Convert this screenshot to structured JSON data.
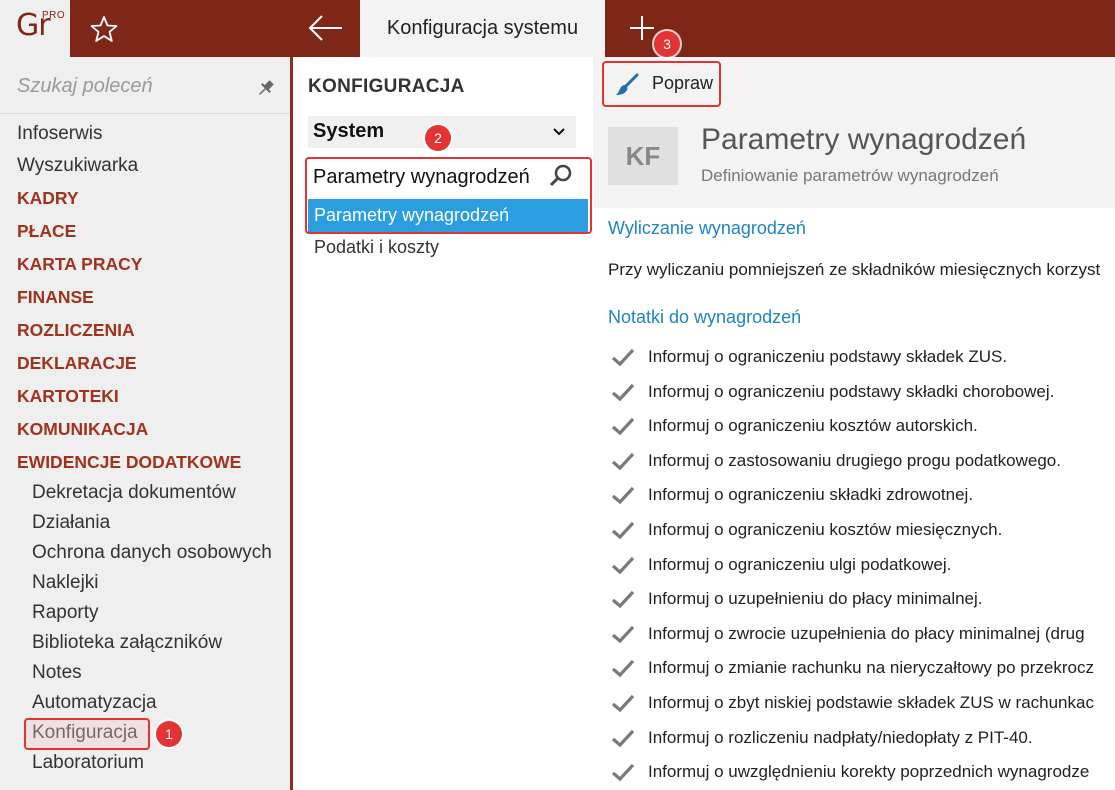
{
  "app": {
    "logo_text": "Gr",
    "logo_badge": "PRO",
    "active_tab": "Konfiguracja systemu"
  },
  "left": {
    "search_placeholder": "Szukaj poleceń",
    "items": [
      {
        "label": "Infoserwis",
        "kind": "item"
      },
      {
        "label": "Wyszukiwarka",
        "kind": "item"
      },
      {
        "label": "KADRY",
        "kind": "section"
      },
      {
        "label": "PŁACE",
        "kind": "section"
      },
      {
        "label": "KARTA PRACY",
        "kind": "section"
      },
      {
        "label": "FINANSE",
        "kind": "section"
      },
      {
        "label": "ROZLICZENIA",
        "kind": "section"
      },
      {
        "label": "DEKLARACJE",
        "kind": "section"
      },
      {
        "label": "KARTOTEKI",
        "kind": "section"
      },
      {
        "label": "KOMUNIKACJA",
        "kind": "section"
      },
      {
        "label": "EWIDENCJE DODATKOWE",
        "kind": "section"
      }
    ],
    "subitems": [
      "Dekretacja dokumentów",
      "Działania",
      "Ochrona danych osobowych",
      "Naklejki",
      "Raporty",
      "Biblioteka załączników",
      "Notes",
      "Automatyzacja",
      "Konfiguracja",
      "Laboratorium"
    ]
  },
  "middle": {
    "title": "KONFIGURACJA",
    "select_value": "System",
    "search_value": "Parametry wynagrodzeń",
    "results": [
      "Parametry wynagrodzeń",
      "Podatki i koszty"
    ]
  },
  "right": {
    "toolbar_button": "Popraw",
    "badge": "KF",
    "title": "Parametry wynagrodzeń",
    "subtitle": "Definiowanie parametrów wynagrodzeń",
    "section1": "Wyliczanie wynagrodzeń",
    "paragraph": "Przy wyliczaniu pomniejszeń ze składników miesięcznych korzyst",
    "section2": "Notatki do wynagrodzeń",
    "checks": [
      "Informuj o ograniczeniu podstawy składek ZUS.",
      "Informuj o ograniczeniu podstawy składki chorobowej.",
      "Informuj o ograniczeniu kosztów autorskich.",
      "Informuj o zastosowaniu drugiego progu podatkowego.",
      "Informuj o ograniczeniu składki zdrowotnej.",
      "Informuj o ograniczeniu kosztów miesięcznych.",
      "Informuj o ograniczeniu ulgi podatkowej.",
      "Informuj o uzupełnieniu do płacy minimalnej.",
      "Informuj o zwrocie uzupełnienia do płacy minimalnej (drug",
      "Informuj o zmianie rachunku na nieryczałtowy po przekrocz",
      "Informuj o zbyt niskiej podstawie składek ZUS w rachunkac",
      "Informuj o rozliczeniu nadpłaty/niedopłaty z PIT-40.",
      "Informuj o uwzględnieniu korekty poprzednich wynagrodze"
    ]
  },
  "annotations": [
    "1",
    "2",
    "3"
  ],
  "colors": {
    "topbar": "#7e2717",
    "section_text": "#a0331d",
    "selection": "#2a9ee0",
    "link": "#1f84c2",
    "annotation": "#e23434"
  }
}
